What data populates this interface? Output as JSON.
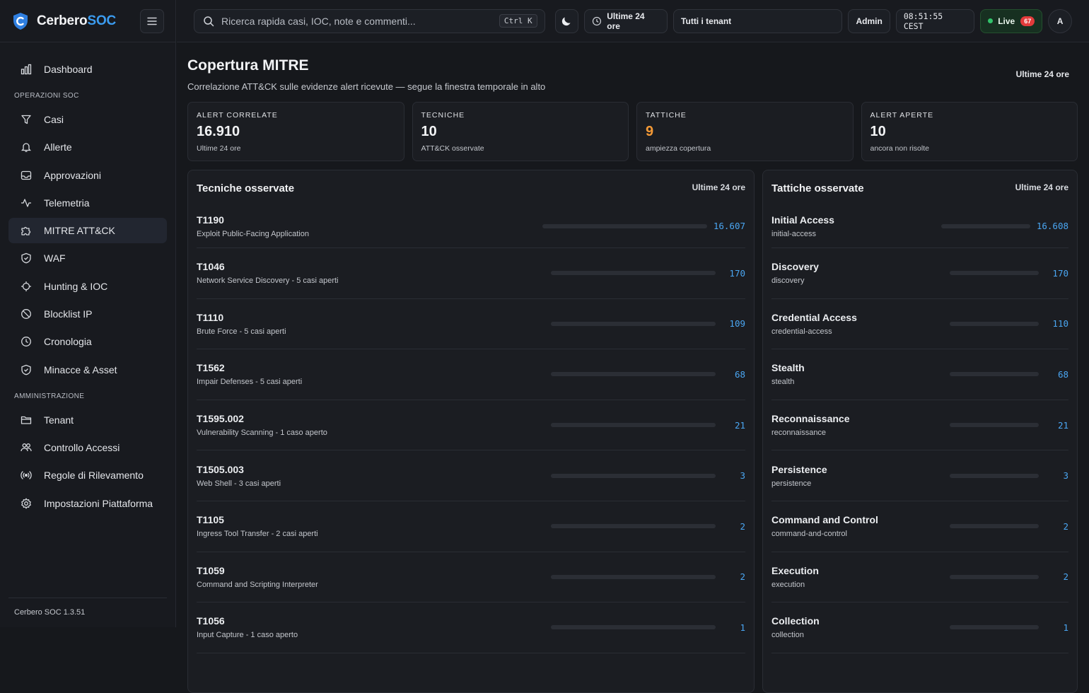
{
  "brand": {
    "name_main": "Cerbero",
    "name_accent": "SOC"
  },
  "sidebar": {
    "top_item": {
      "label": "Dashboard",
      "icon": "bar-chart-icon"
    },
    "section_ops": "OPERAZIONI SOC",
    "ops_items": [
      {
        "label": "Casi",
        "icon": "funnel-icon",
        "active": false
      },
      {
        "label": "Allerte",
        "icon": "bell-icon",
        "active": false
      },
      {
        "label": "Approvazioni",
        "icon": "inbox-icon",
        "active": false
      },
      {
        "label": "Telemetria",
        "icon": "pulse-icon",
        "active": false
      },
      {
        "label": "MITRE ATT&CK",
        "icon": "puzzle-icon",
        "active": true
      },
      {
        "label": "WAF",
        "icon": "shield-icon",
        "active": false
      },
      {
        "label": "Hunting & IOC",
        "icon": "crosshair-icon",
        "active": false
      },
      {
        "label": "Blocklist IP",
        "icon": "ban-icon",
        "active": false
      },
      {
        "label": "Cronologia",
        "icon": "clock-icon",
        "active": false
      },
      {
        "label": "Minacce & Asset",
        "icon": "shield-check-icon",
        "active": false
      }
    ],
    "section_admin": "AMMINISTRAZIONE",
    "admin_items": [
      {
        "label": "Tenant",
        "icon": "folder-icon"
      },
      {
        "label": "Controllo Accessi",
        "icon": "users-icon"
      },
      {
        "label": "Regole di Rilevamento",
        "icon": "radio-icon"
      },
      {
        "label": "Impostazioni Piattaforma",
        "icon": "gear-icon"
      }
    ],
    "version": "Cerbero SOC 1.3.51"
  },
  "topbar": {
    "search_placeholder": "Ricerca rapida casi, IOC, note e commenti...",
    "shortcut": "Ctrl K",
    "time_range": "Ultime 24 ore",
    "tenant": "Tutti i tenant",
    "role": "Admin",
    "clock": "08:51:55 CEST",
    "live_label": "Live",
    "live_count": "67",
    "avatar": "A"
  },
  "page": {
    "title": "Copertura MITRE",
    "subtitle": "Correlazione ATT&CK sulle evidenze alert ricevute — segue la finestra temporale in alto",
    "window": "Ultime 24 ore"
  },
  "stats": [
    {
      "label": "ALERT CORRELATE",
      "value": "16.910",
      "sub": "Ultime 24 ore",
      "accent": false
    },
    {
      "label": "TECNICHE",
      "value": "10",
      "sub": "ATT&CK osservate",
      "accent": false
    },
    {
      "label": "TATTICHE",
      "value": "9",
      "sub": "ampiezza copertura",
      "accent": true
    },
    {
      "label": "ALERT APERTE",
      "value": "10",
      "sub": "ancora non risolte",
      "accent": false
    }
  ],
  "techniques": {
    "title": "Tecniche osservate",
    "window": "Ultime 24 ore",
    "rows": [
      {
        "code": "T1190",
        "desc": "Exploit Public-Facing Application",
        "count": "16.607",
        "fill": 0.0
      },
      {
        "code": "T1046",
        "desc": "Network Service Discovery - 5 casi aperti",
        "count": "170",
        "fill": 0.0
      },
      {
        "code": "T1110",
        "desc": "Brute Force - 5 casi aperti",
        "count": "109",
        "fill": 0.0
      },
      {
        "code": "T1562",
        "desc": "Impair Defenses - 5 casi aperti",
        "count": "68",
        "fill": 0.0
      },
      {
        "code": "T1595.002",
        "desc": "Vulnerability Scanning - 1 caso aperto",
        "count": "21",
        "fill": 0.0
      },
      {
        "code": "T1505.003",
        "desc": "Web Shell - 3 casi aperti",
        "count": "3",
        "fill": 0.0
      },
      {
        "code": "T1105",
        "desc": "Ingress Tool Transfer - 2 casi aperti",
        "count": "2",
        "fill": 0.0
      },
      {
        "code": "T1059",
        "desc": "Command and Scripting Interpreter",
        "count": "2",
        "fill": 0.0
      },
      {
        "code": "T1056",
        "desc": "Input Capture - 1 caso aperto",
        "count": "1",
        "fill": 0.0
      }
    ]
  },
  "tactics": {
    "title": "Tattiche osservate",
    "window": "Ultime 24 ore",
    "rows": [
      {
        "name": "Initial Access",
        "slug": "initial-access",
        "count": "16.608",
        "fill": 0.0
      },
      {
        "name": "Discovery",
        "slug": "discovery",
        "count": "170",
        "fill": 0.0
      },
      {
        "name": "Credential Access",
        "slug": "credential-access",
        "count": "110",
        "fill": 0.0
      },
      {
        "name": "Stealth",
        "slug": "stealth",
        "count": "68",
        "fill": 0.0
      },
      {
        "name": "Reconnaissance",
        "slug": "reconnaissance",
        "count": "21",
        "fill": 0.0
      },
      {
        "name": "Persistence",
        "slug": "persistence",
        "count": "3",
        "fill": 0.0
      },
      {
        "name": "Command and Control",
        "slug": "command-and-control",
        "count": "2",
        "fill": 0.0
      },
      {
        "name": "Execution",
        "slug": "execution",
        "count": "2",
        "fill": 0.0
      },
      {
        "name": "Collection",
        "slug": "collection",
        "count": "1",
        "fill": 0.0
      }
    ]
  },
  "colors": {
    "accent": "#3b9cf0",
    "orange": "#f59a36",
    "live": "#32c36b",
    "badge": "#e23b3b"
  }
}
